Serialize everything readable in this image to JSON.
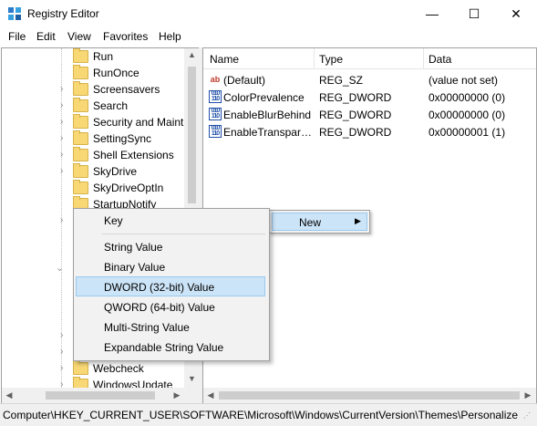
{
  "window": {
    "title": "Registry Editor",
    "controls": {
      "minimize": "—",
      "maximize": "☐",
      "close": "✕"
    }
  },
  "menu": [
    "File",
    "Edit",
    "View",
    "Favorites",
    "Help"
  ],
  "tree": {
    "items": [
      {
        "label": "Run",
        "expandable": false
      },
      {
        "label": "RunOnce",
        "expandable": false
      },
      {
        "label": "Screensavers",
        "expandable": true
      },
      {
        "label": "Search",
        "expandable": true
      },
      {
        "label": "Security and Maint",
        "expandable": true
      },
      {
        "label": "SettingSync",
        "expandable": true
      },
      {
        "label": "Shell Extensions",
        "expandable": true
      },
      {
        "label": "SkyDrive",
        "expandable": true
      },
      {
        "label": "SkyDriveOptIn",
        "expandable": false
      },
      {
        "label": "StartupNotify",
        "expandable": false
      },
      {
        "label": "Webcheck",
        "expandable": true
      },
      {
        "label": "WindowsUpdate",
        "expandable": true
      }
    ]
  },
  "values_list": {
    "headers": [
      "Name",
      "Type",
      "Data"
    ],
    "rows": [
      {
        "icon": "string-value-icon",
        "name": "(Default)",
        "type": "REG_SZ",
        "data": "(value not set)"
      },
      {
        "icon": "dword-value-icon",
        "name": "ColorPrevalence",
        "type": "REG_DWORD",
        "data": "0x00000000 (0)"
      },
      {
        "icon": "dword-value-icon",
        "name": "EnableBlurBehind",
        "type": "REG_DWORD",
        "data": "0x00000000 (0)"
      },
      {
        "icon": "dword-value-icon",
        "name": "EnableTranspare...",
        "type": "REG_DWORD",
        "data": "0x00000001 (1)"
      }
    ]
  },
  "context_menu": {
    "new_label": "New",
    "submenu": {
      "items": [
        "Key",
        "String Value",
        "Binary Value",
        "DWORD (32-bit) Value",
        "QWORD (64-bit) Value",
        "Multi-String Value",
        "Expandable String Value"
      ],
      "highlighted": "DWORD (32-bit) Value"
    }
  },
  "status_bar": {
    "path": "Computer\\HKEY_CURRENT_USER\\SOFTWARE\\Microsoft\\Windows\\CurrentVersion\\Themes\\Personalize"
  },
  "colors": {
    "folder": "#f8d775",
    "highlight": "#cce4f7",
    "highlight_border": "#99c9ef"
  }
}
